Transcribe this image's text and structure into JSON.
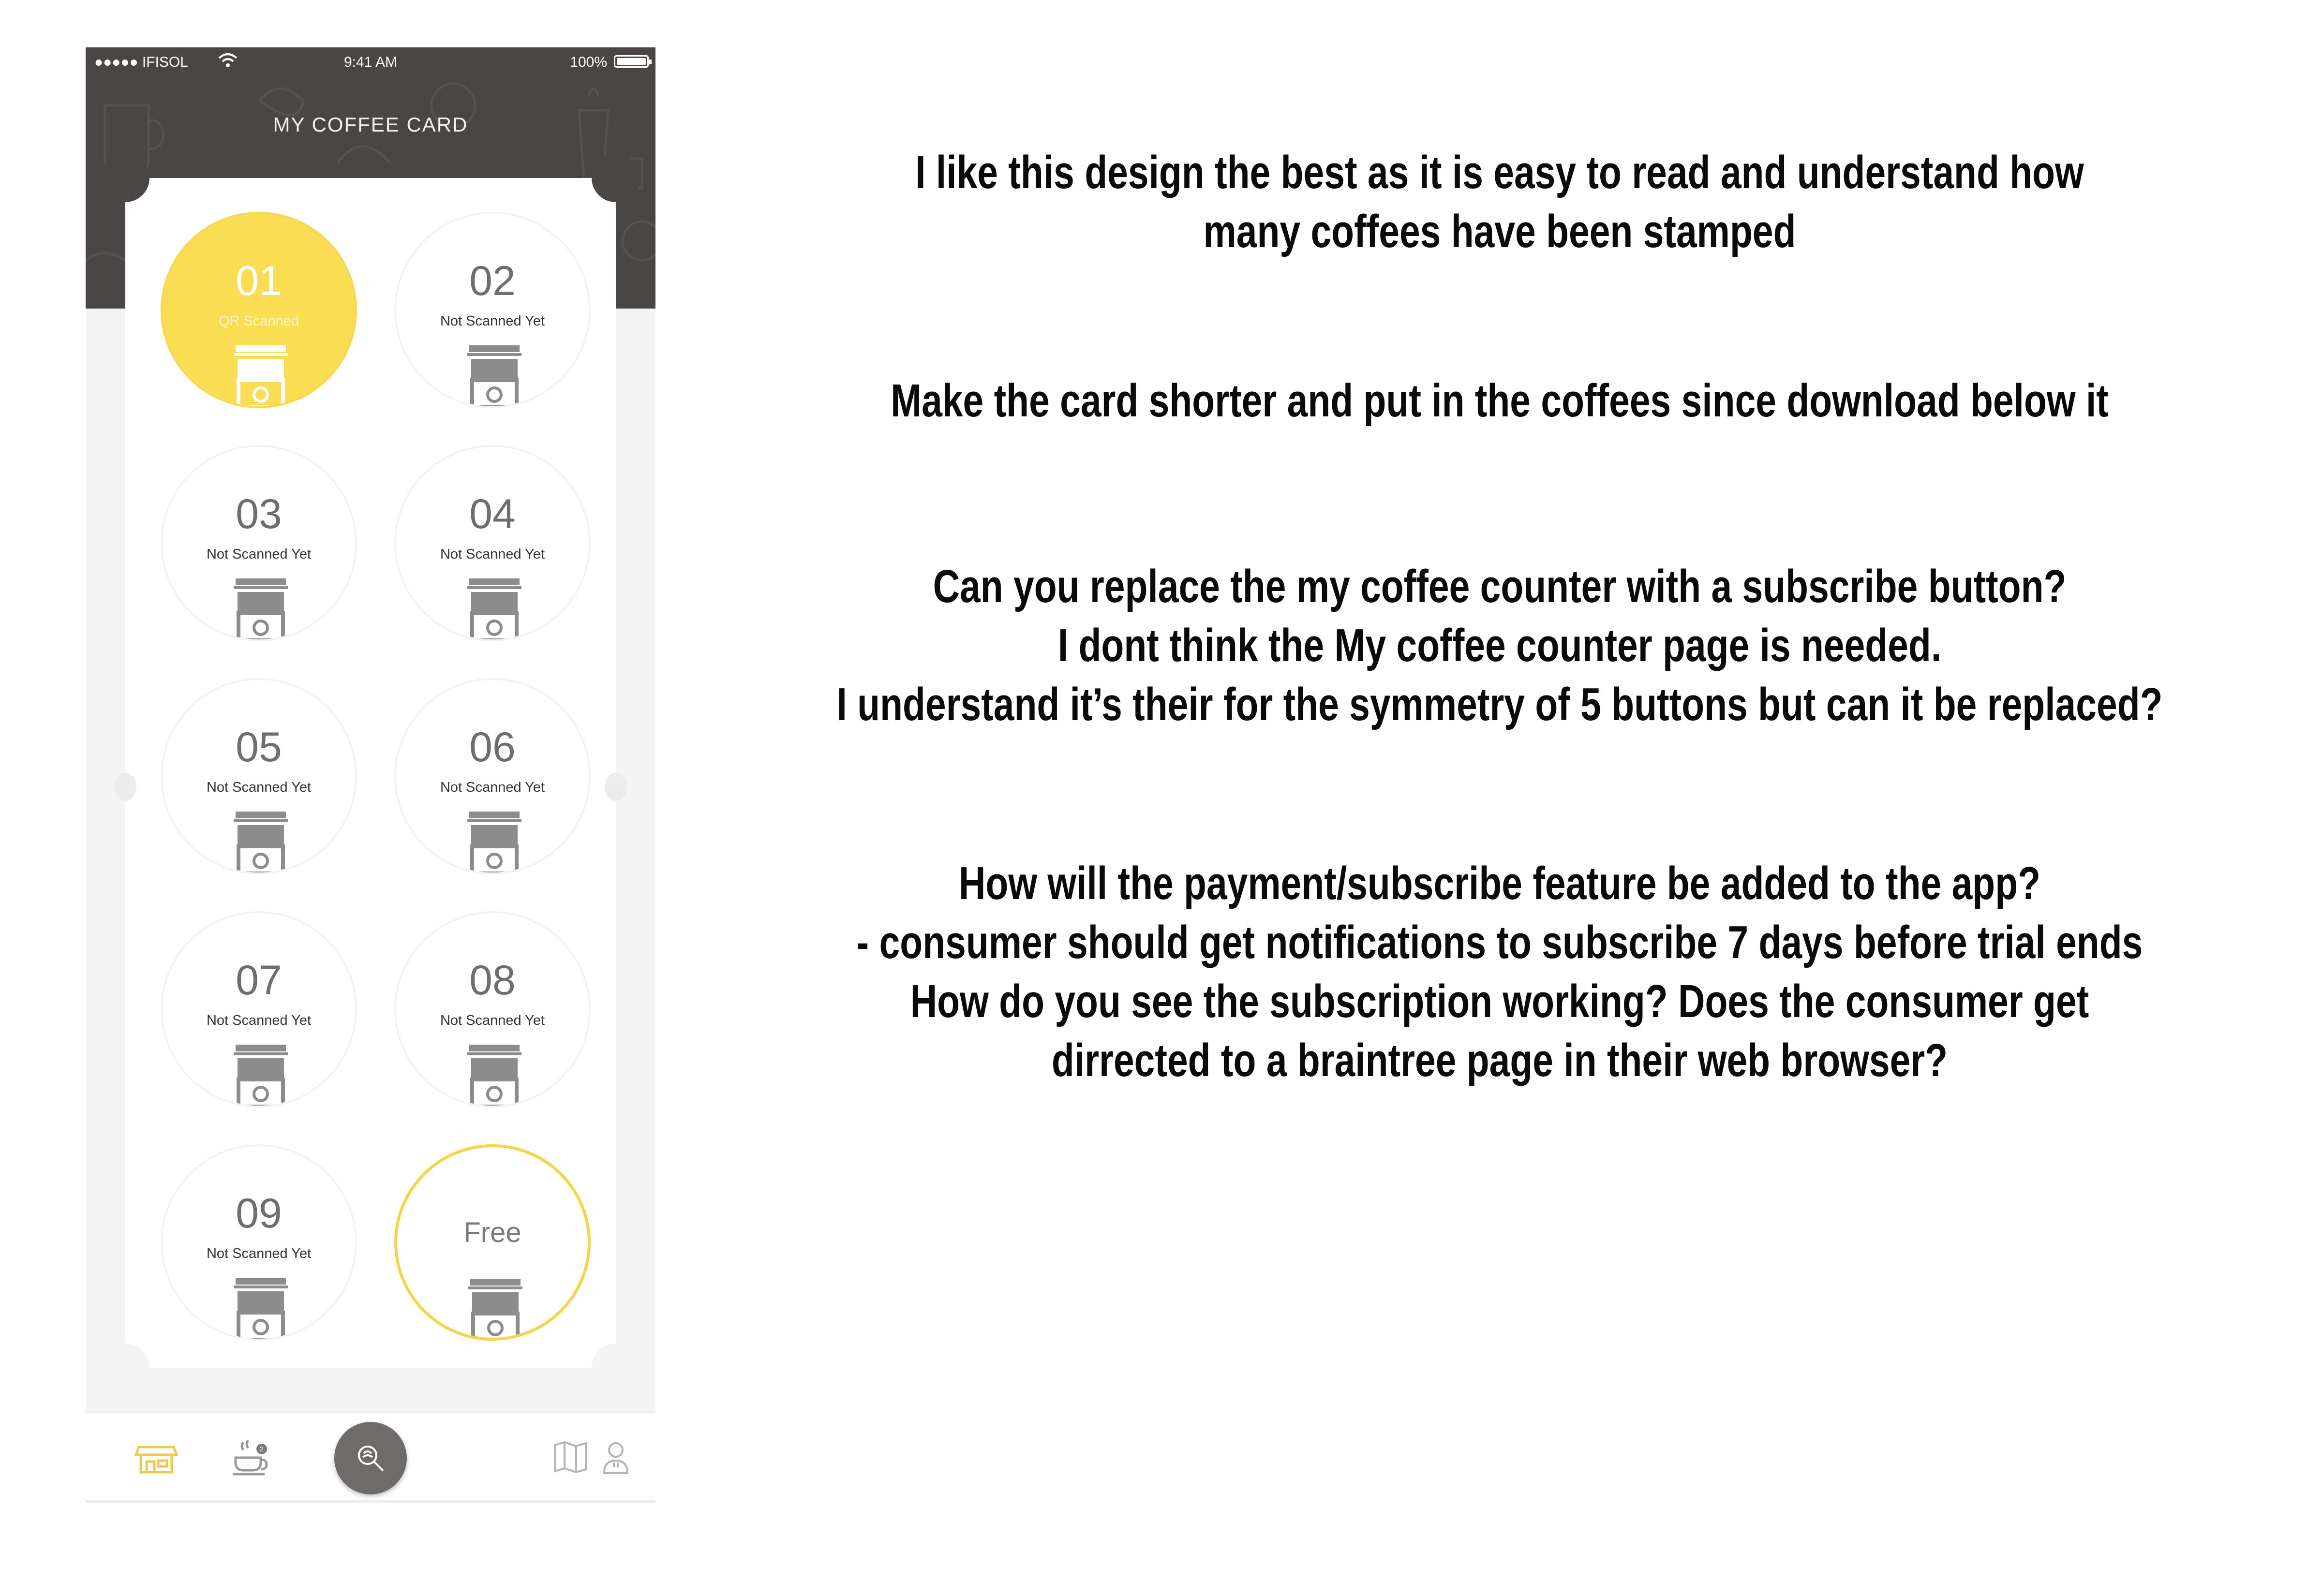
{
  "status_bar": {
    "carrier": "●●●●● IFISOL",
    "time": "9:41 AM",
    "battery": "100%"
  },
  "screen": {
    "title": "MY COFFEE CARD"
  },
  "stamps": [
    {
      "number": "01",
      "status": "QR Scanned",
      "scanned": true
    },
    {
      "number": "02",
      "status": "Not Scanned Yet",
      "scanned": false
    },
    {
      "number": "03",
      "status": "Not Scanned Yet",
      "scanned": false
    },
    {
      "number": "04",
      "status": "Not Scanned Yet",
      "scanned": false
    },
    {
      "number": "05",
      "status": "Not Scanned Yet",
      "scanned": false
    },
    {
      "number": "06",
      "status": "Not Scanned Yet",
      "scanned": false
    },
    {
      "number": "07",
      "status": "Not Scanned Yet",
      "scanned": false
    },
    {
      "number": "08",
      "status": "Not Scanned Yet",
      "scanned": false
    },
    {
      "number": "09",
      "status": "Not Scanned Yet",
      "scanned": false
    },
    {
      "number": "Free",
      "status": "",
      "scanned": false
    }
  ],
  "tab_bar": {
    "items": [
      {
        "icon": "store-icon",
        "active": true
      },
      {
        "icon": "coffee-cup-icon",
        "badge": "2"
      },
      {
        "icon": "qr-scan-icon",
        "center": true
      },
      {
        "icon": "map-icon"
      },
      {
        "icon": "profile-icon"
      }
    ]
  },
  "notes": [
    {
      "lines": [
        "I like this design the best as it is easy to read and understand how",
        "many coffees have been stamped"
      ]
    },
    {
      "lines": [
        "Make the card shorter and put in the coffees since download below it"
      ]
    },
    {
      "lines": [
        "Can you replace the my coffee counter with a subscribe button?",
        "I dont think the My coffee counter page is needed.",
        "I understand it’s their for the symmetry of 5 buttons but can it be replaced?"
      ]
    },
    {
      "lines": [
        "How will the payment/subscribe feature be added to the app?",
        "- consumer should get notifications to subscribe 7 days before trial ends",
        "How do you see the subscription working?  Does the consumer get",
        "dirrected to a braintree page in their web browser?"
      ]
    }
  ],
  "colors": {
    "header": "#4a4646",
    "accent_yellow": "#fbdd54",
    "free_ring": "#f5d547",
    "cup_gray": "#8c8c8c"
  }
}
